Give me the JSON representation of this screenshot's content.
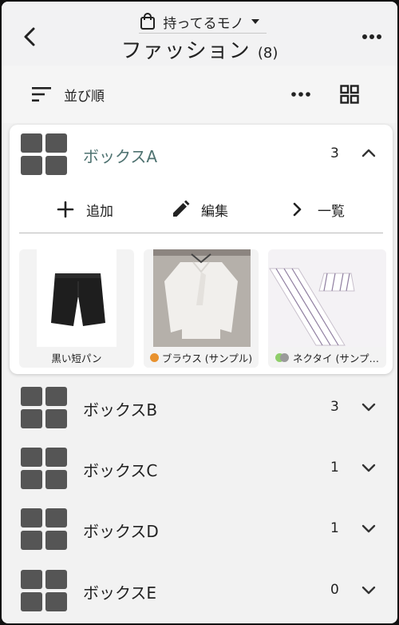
{
  "header": {
    "subtitle": "持ってるモノ",
    "title": "ファッション",
    "count": "(8)"
  },
  "toolbar": {
    "sort_label": "並び順"
  },
  "expanded_box": {
    "name": "ボックスA",
    "count": "3",
    "actions": {
      "add": "追加",
      "edit": "編集",
      "list": "一覧"
    },
    "items": [
      {
        "label": "黒い短パン"
      },
      {
        "label": "ブラウス (サンプル)",
        "tag_color": "#e8912e"
      },
      {
        "label": "ネクタイ (サンプ…",
        "tag_colors": [
          "#8fce6a",
          "#9a9a9a"
        ]
      }
    ]
  },
  "boxes": [
    {
      "name": "ボックスB",
      "count": "3"
    },
    {
      "name": "ボックスC",
      "count": "1"
    },
    {
      "name": "ボックスD",
      "count": "1"
    },
    {
      "name": "ボックスE",
      "count": "0"
    }
  ],
  "colors": {
    "accent_text": "#4e7270",
    "box_icon": "#555555"
  }
}
